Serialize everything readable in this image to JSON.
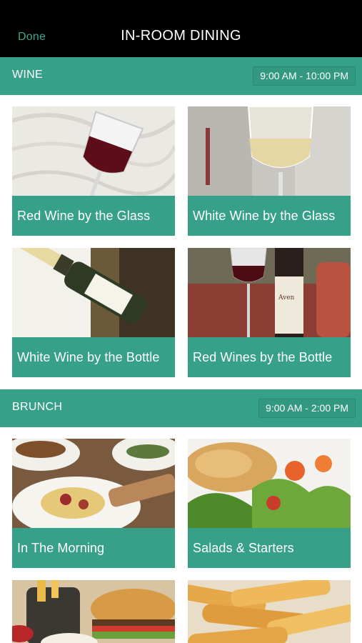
{
  "header": {
    "done_label": "Done",
    "title": "IN-ROOM DINING"
  },
  "sections": [
    {
      "name": "WINE",
      "hours": "9:00 AM - 10:00 PM",
      "items": [
        {
          "label": "Red Wine by the Glass",
          "photo": "red-wine-glass-photo"
        },
        {
          "label": "White Wine by the Glass",
          "photo": "white-wine-glass-photo"
        },
        {
          "label": "White Wine by the Bottle",
          "photo": "white-wine-bottle-photo"
        },
        {
          "label": "Red Wines by the Bottle",
          "photo": "red-wine-bottle-photo"
        }
      ]
    },
    {
      "name": "BRUNCH",
      "hours": "9:00 AM - 2:00 PM",
      "items": [
        {
          "label": "In The Morning",
          "photo": "breakfast-plate-photo"
        },
        {
          "label": "Salads & Starters",
          "photo": "salad-photo"
        },
        {
          "label": "",
          "photo": "burger-fries-photo"
        },
        {
          "label": "",
          "photo": "french-fries-photo"
        }
      ]
    }
  ],
  "colors": {
    "accent": "#36a088",
    "header_bg": "#000000",
    "done_text": "#3fa58c"
  }
}
